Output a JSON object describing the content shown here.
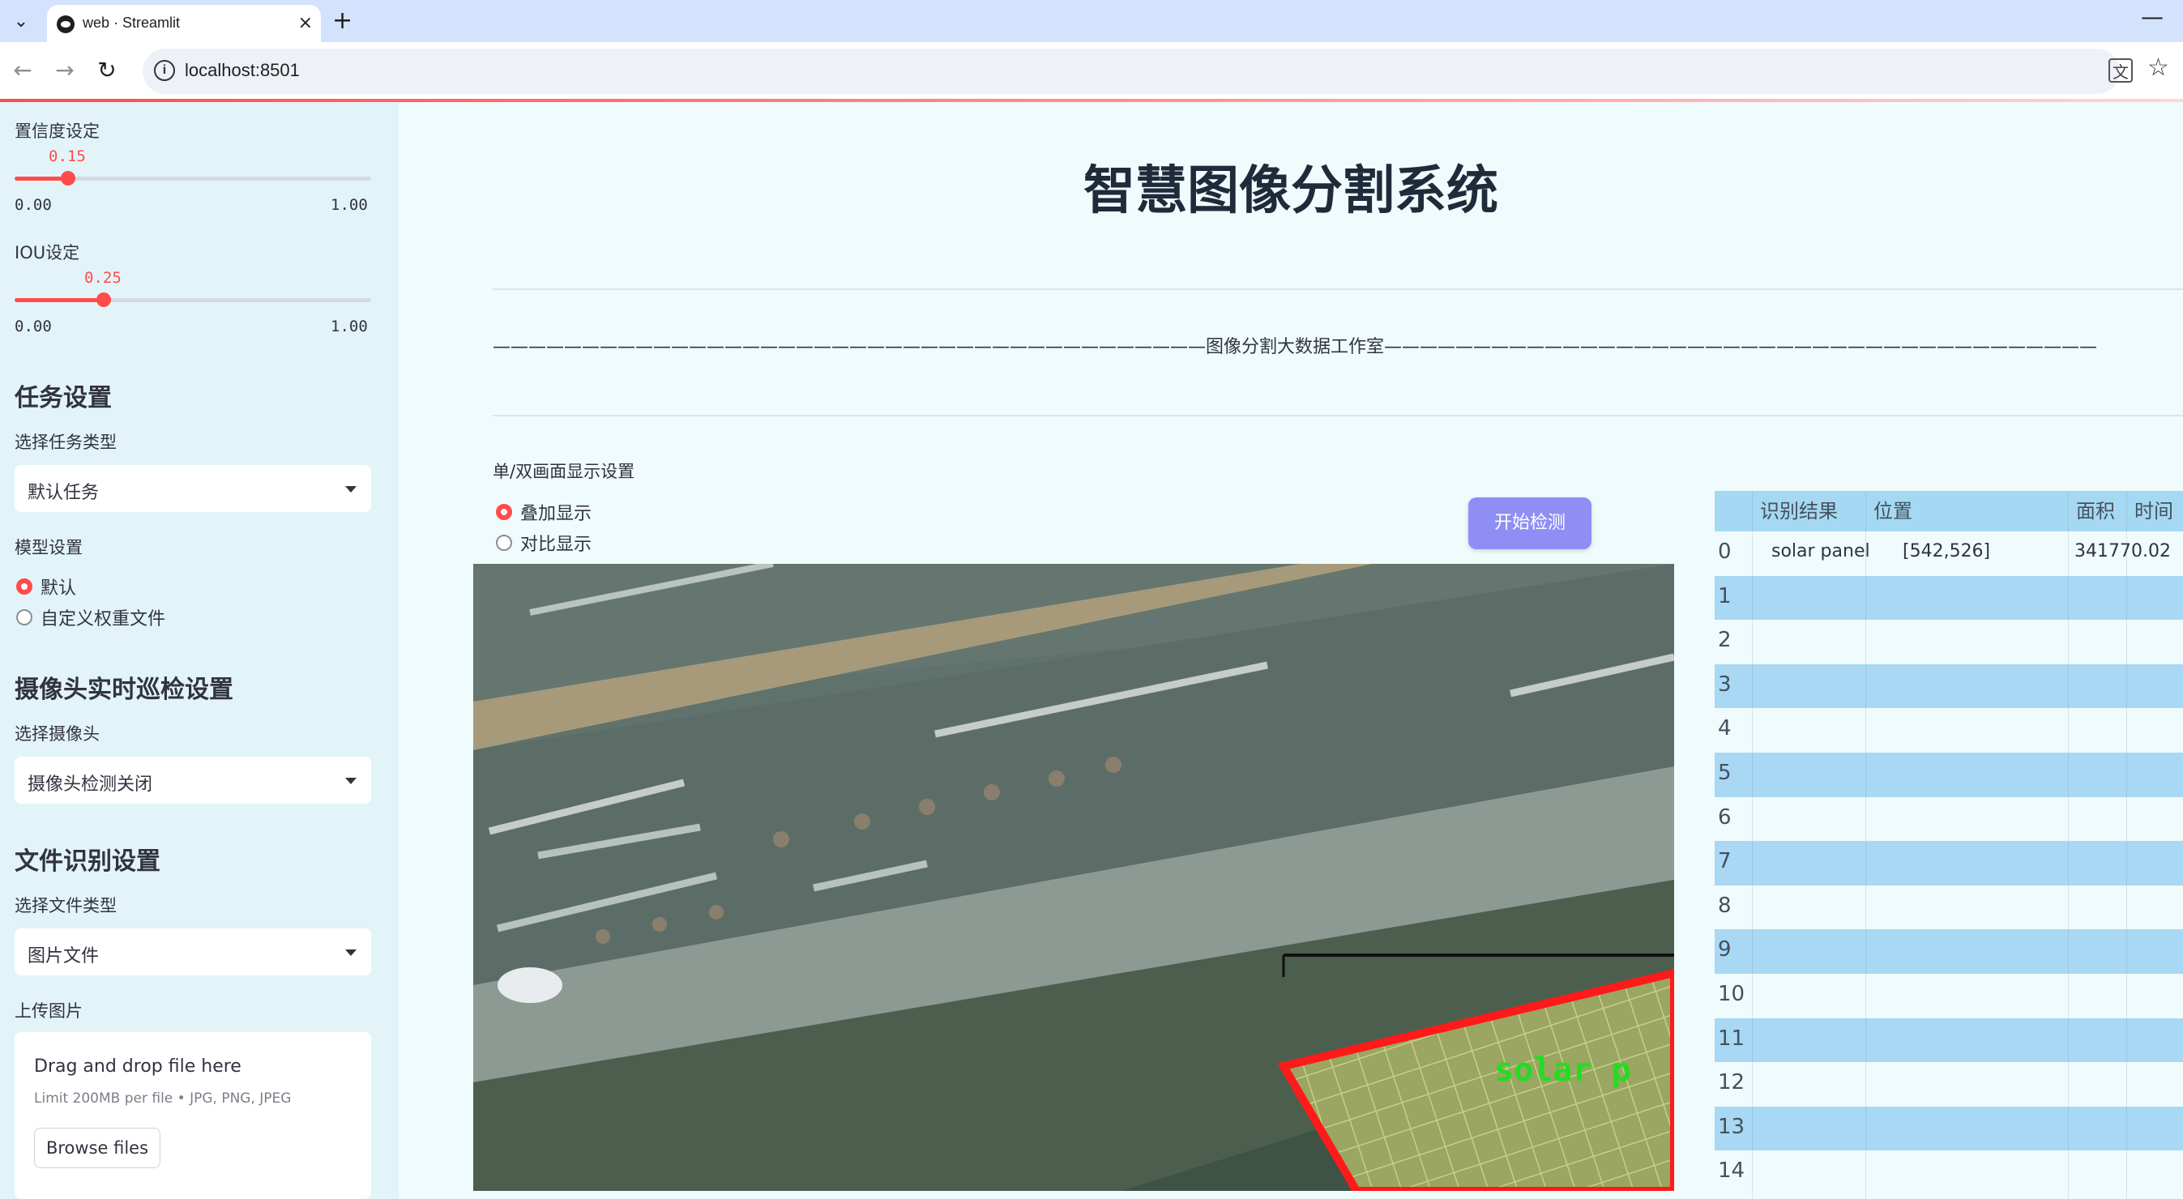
{
  "browser": {
    "tab_title": "web · Streamlit",
    "tab_close": "×",
    "new_tab": "+",
    "minimize": "—",
    "url": "localhost:8501",
    "site_info": "i"
  },
  "sidebar": {
    "confidence": {
      "label": "置信度设定",
      "value": "0.15",
      "value_num": 0.15,
      "min": "0.00",
      "max": "1.00"
    },
    "iou": {
      "label": "IOU设定",
      "value": "0.25",
      "value_num": 0.25,
      "min": "0.00",
      "max": "1.00"
    },
    "task": {
      "heading": "任务设置",
      "label": "选择任务类型",
      "selected": "默认任务"
    },
    "model": {
      "label": "模型设置",
      "options": [
        "默认",
        "自定义权重文件"
      ],
      "selected_index": 0
    },
    "camera": {
      "heading": "摄像头实时巡检设置",
      "label": "选择摄像头",
      "selected": "摄像头检测关闭"
    },
    "file": {
      "heading": "文件识别设置",
      "label": "选择文件类型",
      "selected": "图片文件"
    },
    "upload": {
      "label": "上传图片",
      "drop_title": "Drag and drop file here",
      "limit": "Limit 200MB per file • JPG, PNG, JPEG",
      "browse": "Browse files"
    }
  },
  "main": {
    "title": "智慧图像分割系统",
    "studio_line": "————————————————————————————————————————图像分割大数据工作室————————————————————————————————————————",
    "display_label": "单/双画面显示设置",
    "display_options": [
      "叠加显示",
      "对比显示"
    ],
    "display_selected": 0,
    "start_button": "开始检测",
    "overlay_label": "solar p"
  },
  "table": {
    "columns": [
      "识别结果",
      "位置",
      "面积",
      "时间"
    ],
    "rows": [
      {
        "index": "0",
        "result": "solar panel",
        "position": "[542,526]",
        "area": "34177",
        "time": "0.02"
      },
      {
        "index": "1"
      },
      {
        "index": "2"
      },
      {
        "index": "3"
      },
      {
        "index": "4"
      },
      {
        "index": "5"
      },
      {
        "index": "6"
      },
      {
        "index": "7"
      },
      {
        "index": "8"
      },
      {
        "index": "9"
      },
      {
        "index": "10"
      },
      {
        "index": "11"
      },
      {
        "index": "12"
      },
      {
        "index": "13"
      },
      {
        "index": "14"
      }
    ]
  },
  "colors": {
    "accent": "#ff4b4b",
    "sidebar_bg": "#e3f4f9",
    "main_bg": "#f0fbfd",
    "button": "#8e8ef5",
    "table_stripe": "#a8d8f3",
    "mask_outline": "#ff1a1a",
    "mask_label": "#22dd22"
  }
}
